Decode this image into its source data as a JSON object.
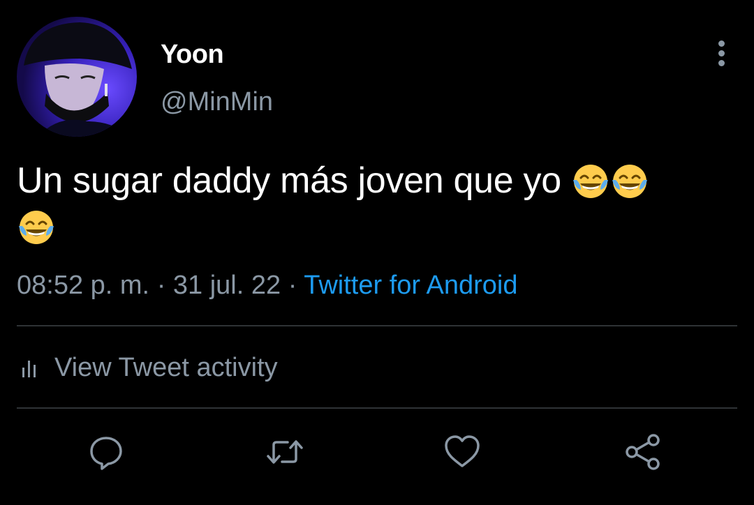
{
  "user": {
    "display_name": "Yoon",
    "handle": "@MinMin"
  },
  "tweet": {
    "text": "Un sugar daddy más joven que yo",
    "emoji": [
      "face-with-tears-of-joy",
      "face-with-tears-of-joy",
      "face-with-tears-of-joy"
    ]
  },
  "meta": {
    "time": "08:52 p. m.",
    "separator": "·",
    "date": "31 jul. 22",
    "source": "Twitter for Android"
  },
  "activity": {
    "label": "View Tweet activity",
    "icon": "bar-chart-icon"
  },
  "actions": [
    {
      "name": "reply",
      "icon": "reply-icon"
    },
    {
      "name": "retweet",
      "icon": "retweet-icon"
    },
    {
      "name": "like",
      "icon": "heart-icon"
    },
    {
      "name": "share",
      "icon": "share-icon"
    }
  ],
  "colors": {
    "background": "#000000",
    "primary_text": "#ffffff",
    "secondary_text": "#8b98a5",
    "link": "#1d9bf0",
    "divider": "#2f3336"
  }
}
